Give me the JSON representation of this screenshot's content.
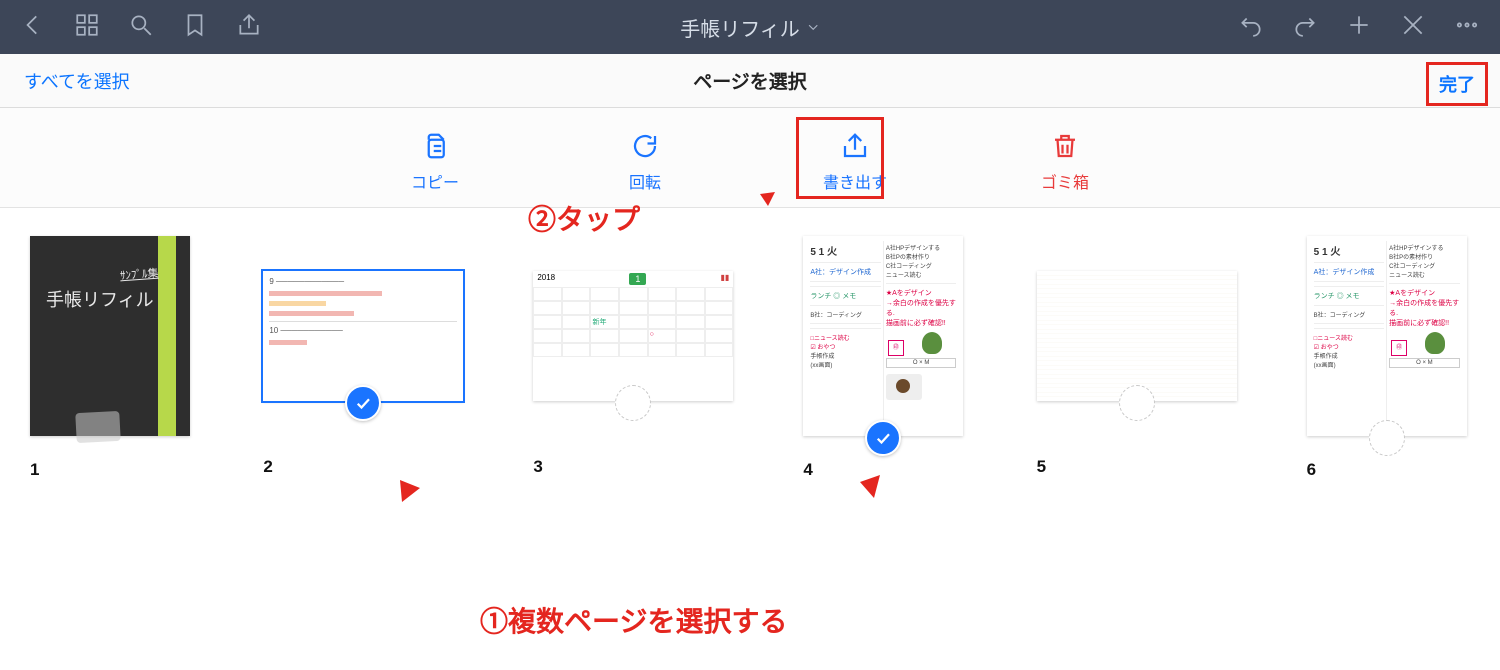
{
  "topbar": {
    "title": "手帳リフィル"
  },
  "selection_header": {
    "select_all": "すべてを選択",
    "heading": "ページを選択",
    "done": "完了"
  },
  "actions": {
    "copy": "コピー",
    "rotate": "回転",
    "export": "書き出す",
    "trash": "ゴミ箱"
  },
  "pages": {
    "p1": {
      "number": "1",
      "cover_title": "手帳リフィル",
      "cover_sub": "ｻﾝﾌﾟﾙ集"
    },
    "p2": {
      "number": "2"
    },
    "p3": {
      "number": "3"
    },
    "p4": {
      "number": "4",
      "date": "5 1 火"
    },
    "p5": {
      "number": "5"
    },
    "p6": {
      "number": "6",
      "date": "5 1 火"
    }
  },
  "annotations": {
    "tap": "②タップ",
    "select_multi": "①複数ページを選択する"
  }
}
